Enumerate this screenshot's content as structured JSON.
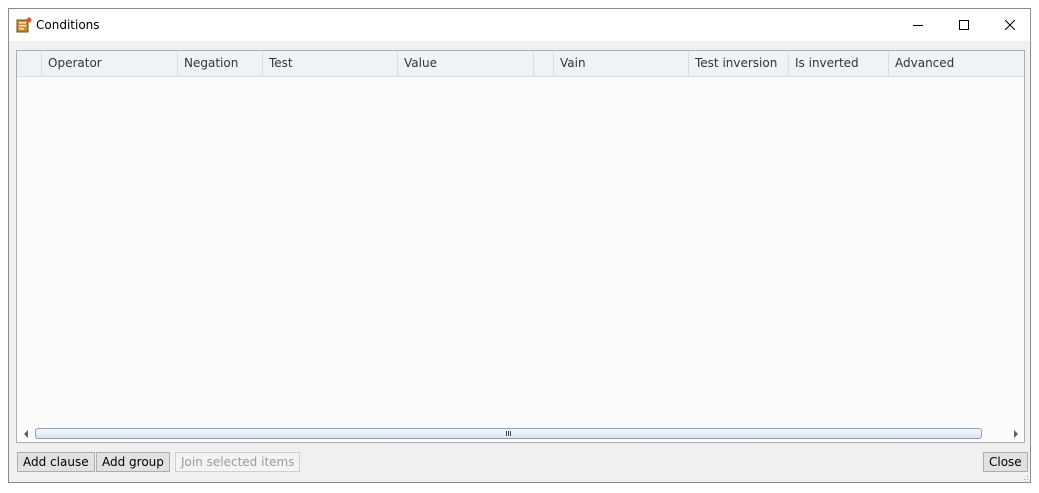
{
  "window": {
    "title": "Conditions",
    "icons": {
      "app": "conditions-app-icon",
      "minimize": "minimize-icon",
      "maximize": "maximize-icon",
      "close": "close-icon"
    }
  },
  "grid": {
    "columns": [
      {
        "label": ""
      },
      {
        "label": "Operator"
      },
      {
        "label": "Negation"
      },
      {
        "label": "Test"
      },
      {
        "label": "Value"
      },
      {
        "label": ""
      },
      {
        "label": "Vain"
      },
      {
        "label": "Test inversion"
      },
      {
        "label": "Is inverted"
      },
      {
        "label": "Advanced"
      }
    ],
    "rows": []
  },
  "buttons": {
    "add_clause": "Add clause",
    "add_group": "Add group",
    "join_selected": "Join selected items",
    "close": "Close"
  },
  "colors": {
    "header_bg": "#eff3f8",
    "grid_bg": "#fcfcfc",
    "button_bg": "#e1e1e1",
    "accent": "#8ca0b8"
  }
}
